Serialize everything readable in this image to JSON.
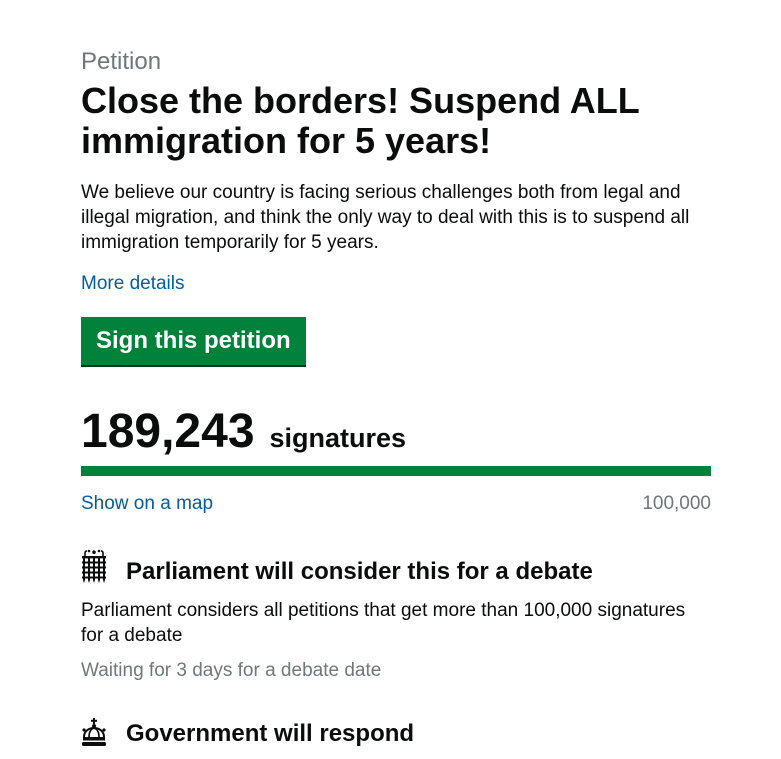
{
  "petition": {
    "kicker": "Petition",
    "title": "Close the borders! Suspend ALL immigration for 5 years!",
    "summary": "We believe our country is facing serious challenges both from legal and illegal migration, and think the only way to deal with this is to suspend all immigration temporarily for 5 years.",
    "more_details_label": "More details"
  },
  "actions": {
    "sign_label": "Sign this petition",
    "map_label": "Show on a map"
  },
  "signatures": {
    "count": "189,243",
    "label": "signatures",
    "threshold": "100,000",
    "progress_fraction": 1.0
  },
  "sections": [
    {
      "icon": "portcullis-icon",
      "heading": "Parliament will consider this for a debate",
      "body": "Parliament considers all petitions that get more than 100,000 signatures for a debate",
      "status": "Waiting for 3 days for a debate date"
    },
    {
      "icon": "crown-icon",
      "heading": "Government will respond"
    }
  ],
  "colors": {
    "accent": "#00823b",
    "link": "#005ea5",
    "muted": "#6f777b",
    "text": "#0b0c0c"
  }
}
